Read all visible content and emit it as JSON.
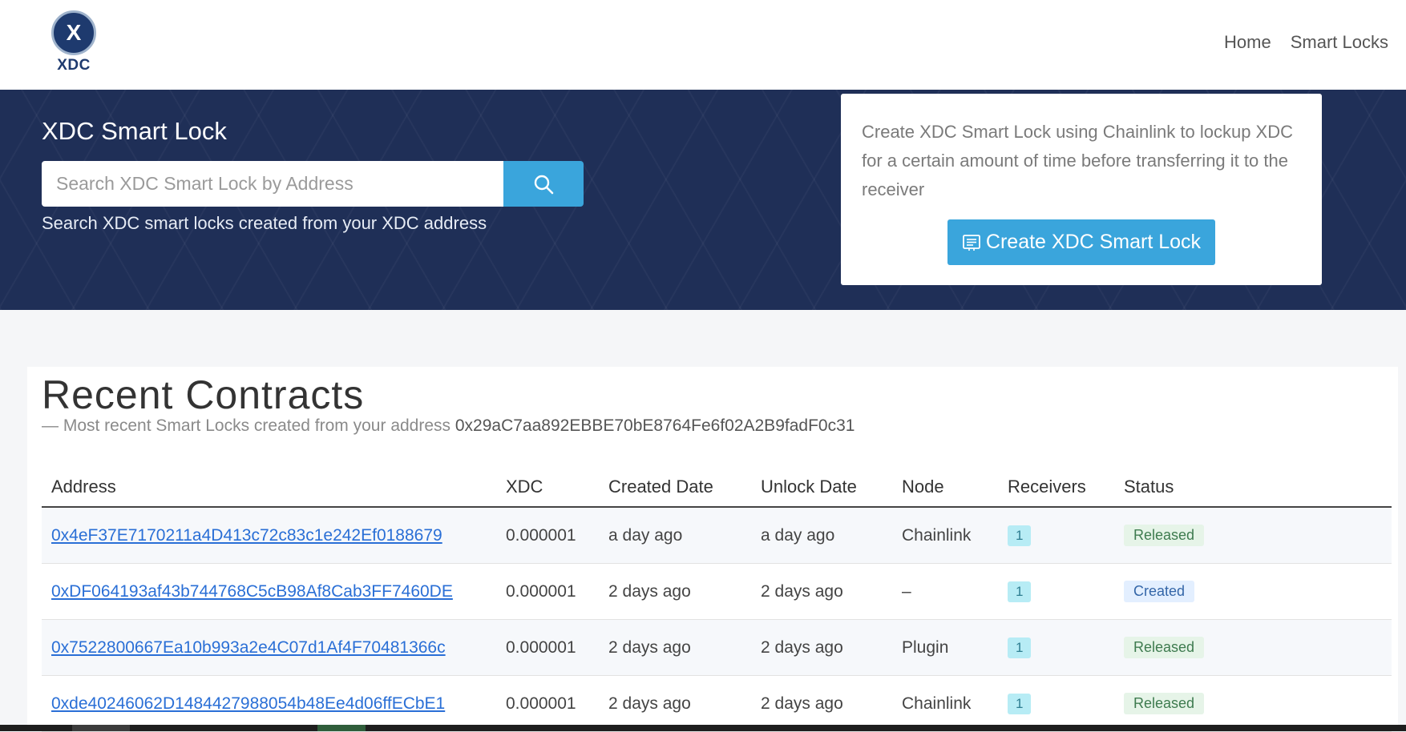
{
  "nav": {
    "logo_letter": "X",
    "logo_text": "XDC",
    "links": [
      "Home",
      "Smart Locks"
    ]
  },
  "hero": {
    "title": "XDC Smart Lock",
    "search_placeholder": "Search XDC Smart Lock by Address",
    "search_value": "",
    "search_hint": "Search XDC smart locks created from your XDC address",
    "create_description": "Create XDC Smart Lock using Chainlink to lockup XDC for a certain amount of time before transferring it to the receiver",
    "create_button_label": "Create XDC Smart Lock"
  },
  "contracts": {
    "title": "Recent Contracts",
    "subtitle_dash": "—",
    "subtitle": "Most recent Smart Locks created from your address",
    "user_address": "0x29aC7aa892EBBE70bE8764Fe6f02A2B9fadF0c31",
    "columns": [
      "Address",
      "XDC",
      "Created Date",
      "Unlock Date",
      "Node",
      "Receivers",
      "Status"
    ],
    "rows": [
      {
        "address": "0x4eF37E7170211a4D413c72c83c1e242Ef0188679",
        "xdc": "0.000001",
        "created": "a day ago",
        "unlock": "a day ago",
        "node": "Chainlink",
        "receivers": "1",
        "status": "Released"
      },
      {
        "address": "0xDF064193af43b744768C5cB98Af8Cab3FF7460DE",
        "xdc": "0.000001",
        "created": "2 days ago",
        "unlock": "2 days ago",
        "node": "–",
        "receivers": "1",
        "status": "Created"
      },
      {
        "address": "0x7522800667Ea10b993a2e4C07d1Af4F70481366c",
        "xdc": "0.000001",
        "created": "2 days ago",
        "unlock": "2 days ago",
        "node": "Plugin",
        "receivers": "1",
        "status": "Released"
      },
      {
        "address": "0xde40246062D1484427988054b48Ee4d06ffECbE1",
        "xdc": "0.000001",
        "created": "2 days ago",
        "unlock": "2 days ago",
        "node": "Chainlink",
        "receivers": "1",
        "status": "Released"
      }
    ]
  },
  "colors": {
    "brand_navy": "#1f2f57",
    "accent_blue": "#3aa5dc",
    "link_blue": "#2a6fd6",
    "released_green": "#3e7b4f",
    "created_blue": "#3466a8"
  },
  "icons": {
    "search": "search-icon",
    "create": "contract-icon"
  }
}
